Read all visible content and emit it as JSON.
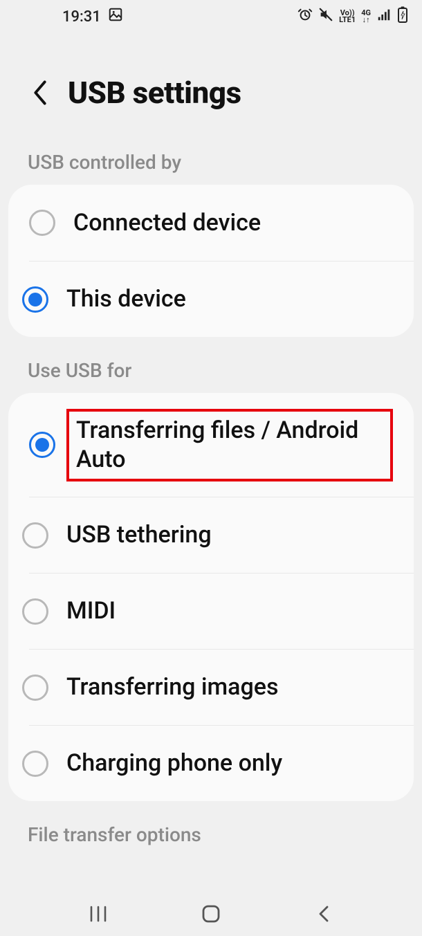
{
  "status": {
    "time": "19:31"
  },
  "header": {
    "title": "USB settings"
  },
  "section1": {
    "label": "USB controlled by",
    "items": [
      {
        "label": "Connected device",
        "selected": false
      },
      {
        "label": "This device",
        "selected": true
      }
    ]
  },
  "section2": {
    "label": "Use USB for",
    "items": [
      {
        "label": "Transferring files / Android Auto",
        "selected": true,
        "highlighted": true
      },
      {
        "label": "USB tethering",
        "selected": false
      },
      {
        "label": "MIDI",
        "selected": false
      },
      {
        "label": "Transferring images",
        "selected": false
      },
      {
        "label": "Charging phone only",
        "selected": false
      }
    ]
  },
  "section3": {
    "label": "File transfer options"
  }
}
